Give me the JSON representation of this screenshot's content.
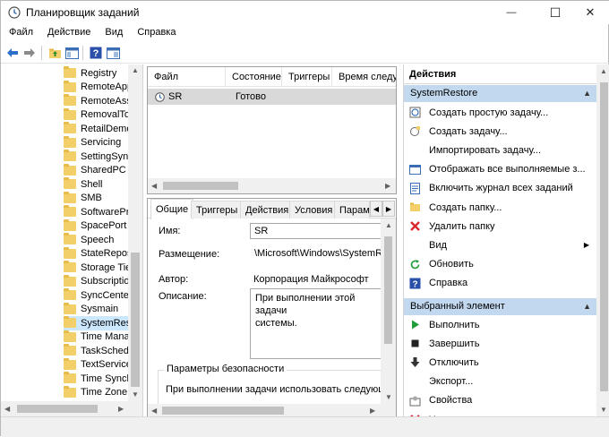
{
  "window": {
    "title": "Планировщик заданий",
    "controls": {
      "minimize": "—",
      "maximize": "☐",
      "close": "✕"
    }
  },
  "menu": [
    "Файл",
    "Действие",
    "Вид",
    "Справка"
  ],
  "toolbar": [
    "back-arrow-icon",
    "forward-arrow-icon",
    "up-folder-icon",
    "show-hide-tree-icon",
    "help-icon",
    "properties-icon"
  ],
  "tree": {
    "items": [
      "Registry",
      "RemoteApp",
      "RemoteAss",
      "RemovalToo",
      "RetailDemo",
      "Servicing",
      "SettingSync",
      "SharedPC",
      "Shell",
      "SMB",
      "SoftwarePro",
      "SpacePort",
      "Speech",
      "StateReposi",
      "Storage Tier",
      "Subscriptio",
      "SyncCenter",
      "Sysmain",
      "SystemRest",
      "Time Manag",
      "TaskSchedu",
      "TextServices",
      "Time Synch",
      "Time Zone"
    ],
    "selected_index": 18
  },
  "task_list": {
    "columns": [
      "Файл",
      "Состояние",
      "Триггеры",
      "Время следу"
    ],
    "rows": [
      {
        "name": "SR",
        "state": "Готово",
        "triggers": "",
        "next": ""
      }
    ]
  },
  "tabs": [
    "Общие",
    "Триггеры",
    "Действия",
    "Условия",
    "Парам"
  ],
  "general": {
    "name_label": "Имя:",
    "name_value": "SR",
    "location_label": "Размещение:",
    "location_value": "\\Microsoft\\Windows\\SystemRes",
    "author_label": "Автор:",
    "author_value": "Корпорация Майкрософт",
    "description_label": "Описание:",
    "description_value": "При выполнении этой задачи\nсистемы.",
    "security_title": "Параметры безопасности",
    "security_text": "При выполнении задачи использовать следующую"
  },
  "actions": {
    "header": "Действия",
    "section1_title": "SystemRestore",
    "section1_items": [
      {
        "icon": "create-basic-task-icon",
        "label": "Создать простую задачу..."
      },
      {
        "icon": "create-task-icon",
        "label": "Создать задачу..."
      },
      {
        "icon": "",
        "label": "Импортировать задачу..."
      },
      {
        "icon": "display-running-icon",
        "label": "Отображать все выполняемые з..."
      },
      {
        "icon": "enable-history-icon",
        "label": "Включить журнал всех заданий"
      },
      {
        "icon": "new-folder-icon",
        "label": "Создать папку..."
      },
      {
        "icon": "delete-folder-icon",
        "label": "Удалить папку"
      },
      {
        "icon": "",
        "label": "Вид"
      },
      {
        "icon": "refresh-icon",
        "label": "Обновить"
      },
      {
        "icon": "help-icon",
        "label": "Справка"
      }
    ],
    "section2_title": "Выбранный элемент",
    "section2_items": [
      {
        "icon": "run-icon",
        "label": "Выполнить"
      },
      {
        "icon": "end-icon",
        "label": "Завершить"
      },
      {
        "icon": "disable-icon",
        "label": "Отключить"
      },
      {
        "icon": "",
        "label": "Экспорт..."
      },
      {
        "icon": "properties-icon",
        "label": "Свойства"
      },
      {
        "icon": "delete-icon",
        "label": "Удалить"
      }
    ]
  },
  "colors": {
    "section_header": "#c2d8ef",
    "selection": "#cce8ff",
    "folder": "#f3cf6a",
    "delete_red": "#d9262c",
    "run_green": "#1f9d3a"
  }
}
